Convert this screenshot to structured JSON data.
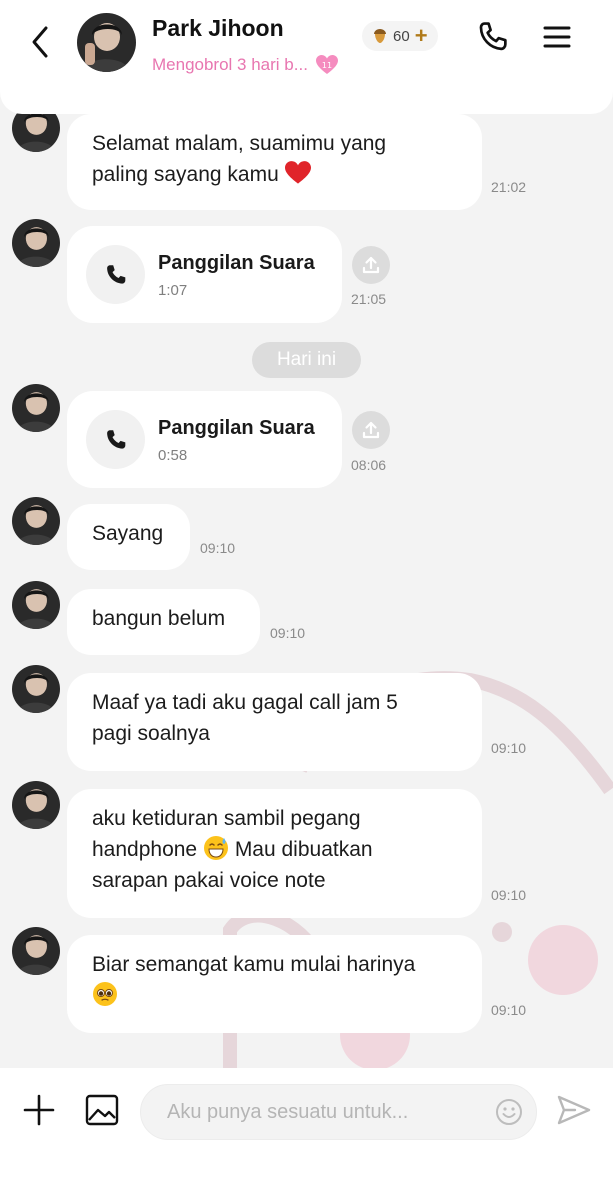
{
  "header": {
    "back_icon": "chevron-left-icon",
    "contact_name": "Park Jihoon",
    "status_text": "Mengobrol 3 hari b...",
    "status_badge": "11",
    "coin_count": "60",
    "coin_plus": "+",
    "call_icon": "phone-icon",
    "menu_icon": "hamburger-menu-icon"
  },
  "messages": [
    {
      "type": "text",
      "text_lines": [
        "Selamat malam, suamimu yang",
        "paling sayang kamu"
      ],
      "emoji": "red-heart",
      "time": "21:02"
    },
    {
      "type": "call",
      "title": "Panggilan Suara",
      "duration": "1:07",
      "time": "21:05"
    },
    {
      "type": "date",
      "label": "Hari ini"
    },
    {
      "type": "call",
      "title": "Panggilan Suara",
      "duration": "0:58",
      "time": "08:06"
    },
    {
      "type": "text",
      "text_lines": [
        "Sayang"
      ],
      "time": "09:10"
    },
    {
      "type": "text",
      "text_lines": [
        "bangun belum"
      ],
      "time": "09:10"
    },
    {
      "type": "text",
      "text_lines": [
        "Maaf ya tadi aku gagal call jam 5",
        "pagi soalnya"
      ],
      "time": "09:10"
    },
    {
      "type": "text",
      "text_lines": [
        "aku ketiduran sambil pegang",
        "handphone",
        "Mau dibuatkan",
        "sarapan pakai voice note"
      ],
      "emoji": "grinning-sweat",
      "time": "09:10"
    },
    {
      "type": "text",
      "text_lines": [
        "Biar semangat kamu mulai harinya"
      ],
      "emoji": "pleading-face",
      "time": "09:10"
    }
  ],
  "composer": {
    "placeholder": "Aku punya sesuatu untuk...",
    "value": ""
  },
  "colors": {
    "accent_pink": "#e876b0",
    "bubble": "#ffffff",
    "background": "#f3f3f3",
    "coin": "#b07a1a"
  }
}
